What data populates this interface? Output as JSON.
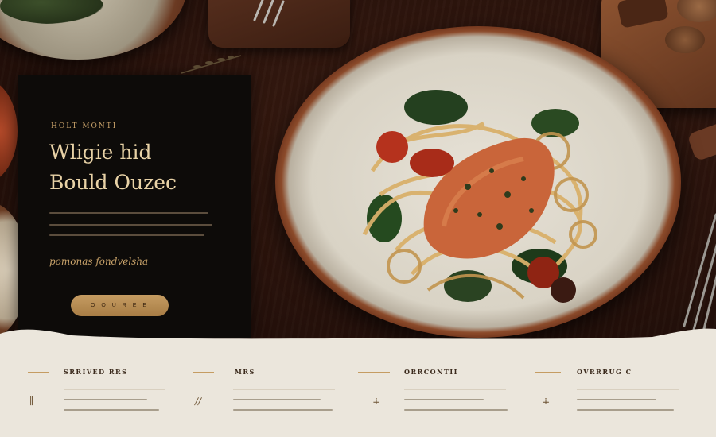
{
  "hero": {
    "eyebrow": "HOLT  MONTI",
    "headline_line1": "Wligie hid",
    "headline_line2": "Bould Ouzec",
    "script_text": "pomonas fondvelsha",
    "cta_label": "O O U R E E"
  },
  "features": [
    {
      "title": "SRRIVED RRS",
      "icon": "∥"
    },
    {
      "title": "MRS",
      "icon": "∕∕"
    },
    {
      "title": "ORRCONTII",
      "icon": "∔"
    },
    {
      "title": "OVRRRUG C",
      "icon": "∔"
    }
  ],
  "colors": {
    "accent": "#c59c62",
    "panel": "#0d0b09",
    "footer_bg": "#ebe6dc",
    "headline": "#e8d2a6"
  }
}
